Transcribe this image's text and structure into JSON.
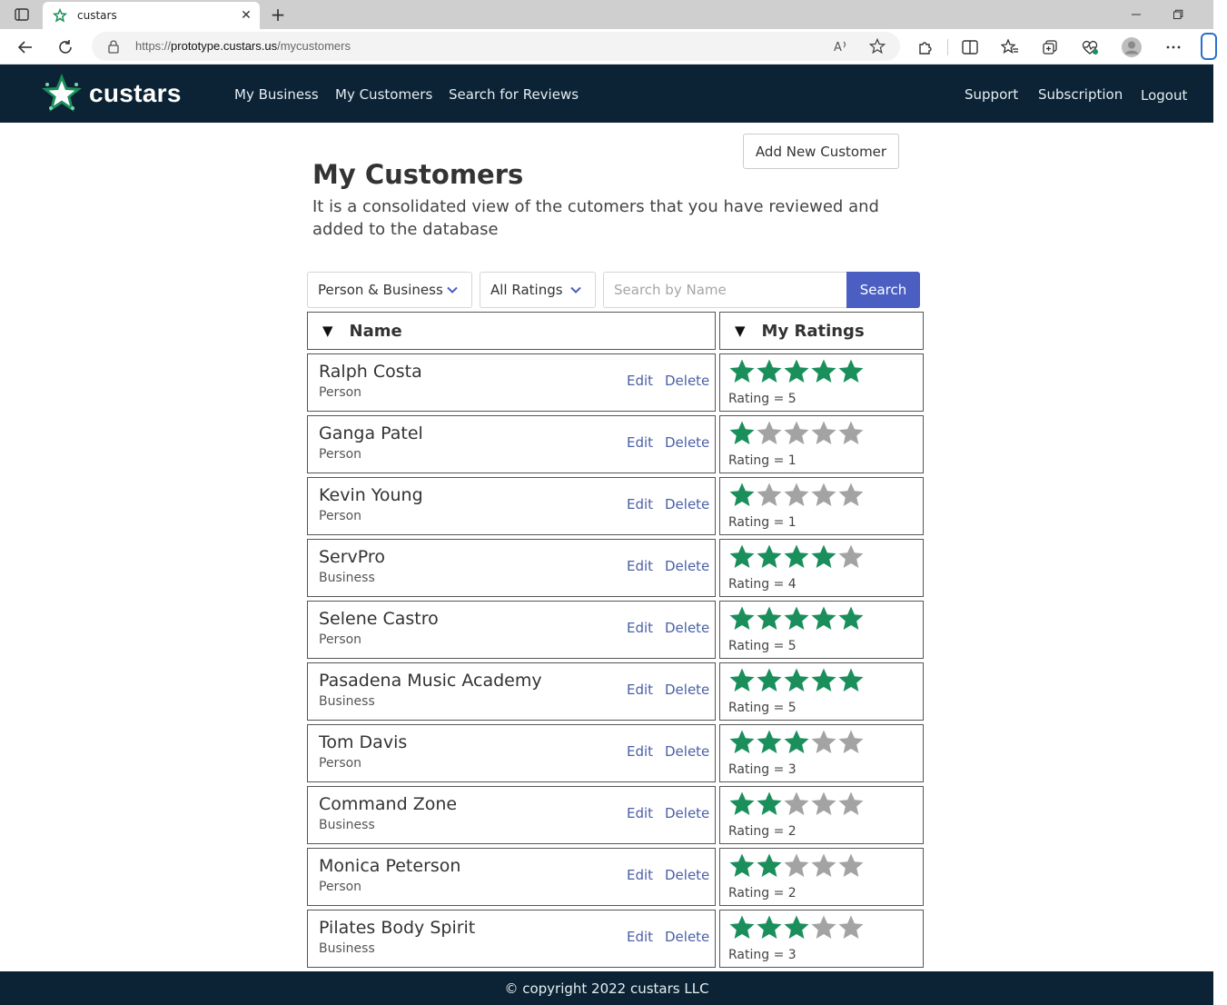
{
  "browser": {
    "tab_title": "custars",
    "url_prefix": "https://",
    "url_host": "prototype.custars.us",
    "url_path": "/mycustomers"
  },
  "header": {
    "brand": "custars",
    "nav_left": [
      "My Business",
      "My Customers",
      "Search for Reviews"
    ],
    "nav_right": [
      "Support",
      "Subscription",
      "Logout"
    ]
  },
  "page": {
    "add_button": "Add New Customer",
    "title": "My Customers",
    "subtitle": "It is a consolidated view of the cutomers that you have reviewed and added to the database"
  },
  "filters": {
    "type_selected": "Person & Business",
    "rating_selected": "All Ratings",
    "search_placeholder": "Search by Name",
    "search_button": "Search"
  },
  "table": {
    "name_header": "Name",
    "ratings_header": "My Ratings",
    "edit_label": "Edit",
    "delete_label": "Delete",
    "rating_prefix": "Rating = ",
    "rows": [
      {
        "name": "Ralph Costa",
        "type": "Person",
        "rating": 5
      },
      {
        "name": "Ganga Patel",
        "type": "Person",
        "rating": 1
      },
      {
        "name": "Kevin Young",
        "type": "Person",
        "rating": 1
      },
      {
        "name": "ServPro",
        "type": "Business",
        "rating": 4
      },
      {
        "name": "Selene Castro",
        "type": "Person",
        "rating": 5
      },
      {
        "name": "Pasadena Music Academy",
        "type": "Business",
        "rating": 5
      },
      {
        "name": "Tom Davis",
        "type": "Person",
        "rating": 3
      },
      {
        "name": "Command Zone",
        "type": "Business",
        "rating": 2
      },
      {
        "name": "Monica Peterson",
        "type": "Person",
        "rating": 2
      },
      {
        "name": "Pilates Body Spirit",
        "type": "Business",
        "rating": 3
      }
    ]
  },
  "footer": {
    "copyright": "© copyright 2022 custars LLC"
  },
  "colors": {
    "header_bg": "#0b2334",
    "star_filled": "#1a8f5c",
    "star_empty": "#a3a3a3",
    "search_button": "#4a5fc1",
    "link": "#4a5fa6"
  },
  "icons": [
    "tab-actions-icon",
    "custars-favicon-icon",
    "close-tab-icon",
    "new-tab-icon",
    "back-icon",
    "refresh-icon",
    "lock-icon",
    "read-aloud-icon",
    "favorite-star-icon",
    "extensions-icon",
    "split-screen-icon",
    "favorites-icon",
    "collections-icon",
    "browser-essentials-icon",
    "profile-icon",
    "more-icon",
    "chevron-down-icon",
    "sort-triangle-icon",
    "star-icon"
  ]
}
